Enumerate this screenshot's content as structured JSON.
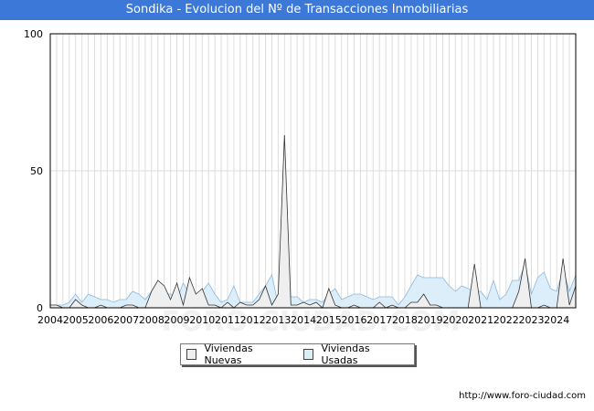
{
  "title": "Sondika - Evolucion del Nº de Transacciones Inmobiliarias",
  "footer_url": "http://www.foro-ciudad.com",
  "watermark": "FORO-CIUDAD.COM",
  "colors": {
    "title_bg": "#3c78d8",
    "nuevas_fill": "#efefef",
    "nuevas_line": "#333333",
    "usadas_fill": "#dceefa",
    "usadas_line": "#8cb8dc",
    "grid": "#dddddd"
  },
  "chart_data": {
    "type": "area",
    "title": "Sondika - Evolucion del Nº de Transacciones Inmobiliarias",
    "xlabel": "",
    "ylabel": "",
    "ylim": [
      0,
      100
    ],
    "yticks": [
      "0",
      "50",
      "100"
    ],
    "x_tick_labels": [
      "2004",
      "2005",
      "2006",
      "2007",
      "2008",
      "2009",
      "2010",
      "2011",
      "2012",
      "2013",
      "2014",
      "2015",
      "2016",
      "2017",
      "2018",
      "2019",
      "2020",
      "2021",
      "2022",
      "2023",
      "2024"
    ],
    "x_start": 2004,
    "x_end": 2024.75,
    "grid": true,
    "legend_position": "bottom",
    "series": [
      {
        "name": "Viviendas Nuevas",
        "x": [
          2004.0,
          2004.25,
          2004.5,
          2004.75,
          2005.0,
          2005.25,
          2005.5,
          2005.75,
          2006.0,
          2006.25,
          2006.5,
          2006.75,
          2007.0,
          2007.25,
          2007.5,
          2007.75,
          2008.0,
          2008.25,
          2008.5,
          2008.75,
          2009.0,
          2009.25,
          2009.5,
          2009.75,
          2010.0,
          2010.25,
          2010.5,
          2010.75,
          2011.0,
          2011.25,
          2011.5,
          2011.75,
          2012.0,
          2012.25,
          2012.5,
          2012.75,
          2013.0,
          2013.25,
          2013.5,
          2013.75,
          2014.0,
          2014.25,
          2014.5,
          2014.75,
          2015.0,
          2015.25,
          2015.5,
          2015.75,
          2016.0,
          2016.25,
          2016.5,
          2016.75,
          2017.0,
          2017.25,
          2017.5,
          2017.75,
          2018.0,
          2018.25,
          2018.5,
          2018.75,
          2019.0,
          2019.25,
          2019.5,
          2019.75,
          2020.0,
          2020.25,
          2020.5,
          2020.75,
          2021.0,
          2021.25,
          2021.5,
          2021.75,
          2022.0,
          2022.25,
          2022.5,
          2022.75,
          2023.0,
          2023.25,
          2023.5,
          2023.75,
          2024.0,
          2024.25,
          2024.5,
          2024.75
        ],
        "values": [
          1,
          1,
          0,
          0,
          3,
          1,
          0,
          0,
          1,
          0,
          0,
          0,
          1,
          1,
          0,
          0,
          6,
          10,
          8,
          3,
          9,
          1,
          11,
          5,
          7,
          1,
          1,
          0,
          2,
          0,
          2,
          1,
          1,
          3,
          8,
          1,
          5,
          63,
          1,
          1,
          2,
          1,
          2,
          0,
          7,
          1,
          0,
          0,
          1,
          0,
          0,
          0,
          2,
          0,
          1,
          0,
          0,
          2,
          2,
          5,
          1,
          1,
          0,
          0,
          0,
          0,
          0,
          16,
          0,
          0,
          0,
          0,
          0,
          0,
          6,
          18,
          0,
          0,
          1,
          0,
          0,
          18,
          1,
          8
        ]
      },
      {
        "name": "Viviendas Usadas",
        "x": [
          2004.0,
          2004.25,
          2004.5,
          2004.75,
          2005.0,
          2005.25,
          2005.5,
          2005.75,
          2006.0,
          2006.25,
          2006.5,
          2006.75,
          2007.0,
          2007.25,
          2007.5,
          2007.75,
          2008.0,
          2008.25,
          2008.5,
          2008.75,
          2009.0,
          2009.25,
          2009.5,
          2009.75,
          2010.0,
          2010.25,
          2010.5,
          2010.75,
          2011.0,
          2011.25,
          2011.5,
          2011.75,
          2012.0,
          2012.25,
          2012.5,
          2012.75,
          2013.0,
          2013.25,
          2013.5,
          2013.75,
          2014.0,
          2014.25,
          2014.5,
          2014.75,
          2015.0,
          2015.25,
          2015.5,
          2015.75,
          2016.0,
          2016.25,
          2016.5,
          2016.75,
          2017.0,
          2017.25,
          2017.5,
          2017.75,
          2018.0,
          2018.25,
          2018.5,
          2018.75,
          2019.0,
          2019.25,
          2019.5,
          2019.75,
          2020.0,
          2020.25,
          2020.5,
          2020.75,
          2021.0,
          2021.25,
          2021.5,
          2021.75,
          2022.0,
          2022.25,
          2022.5,
          2022.75,
          2023.0,
          2023.25,
          2023.5,
          2023.75,
          2024.0,
          2024.25,
          2024.5,
          2024.75
        ],
        "values": [
          1,
          1,
          1,
          2,
          5,
          2,
          5,
          4,
          3,
          3,
          2,
          3,
          3,
          6,
          5,
          3,
          6,
          9,
          5,
          5,
          3,
          9,
          5,
          5,
          6,
          9,
          5,
          2,
          3,
          8,
          2,
          2,
          2,
          5,
          8,
          12,
          1,
          22,
          4,
          4,
          2,
          3,
          3,
          2,
          5,
          7,
          3,
          4,
          5,
          5,
          4,
          3,
          4,
          4,
          4,
          1,
          4,
          8,
          12,
          11,
          11,
          11,
          11,
          8,
          6,
          8,
          7,
          6,
          6,
          3,
          10,
          3,
          5,
          10,
          10,
          16,
          5,
          11,
          13,
          7,
          6,
          14,
          6,
          12
        ]
      }
    ]
  }
}
